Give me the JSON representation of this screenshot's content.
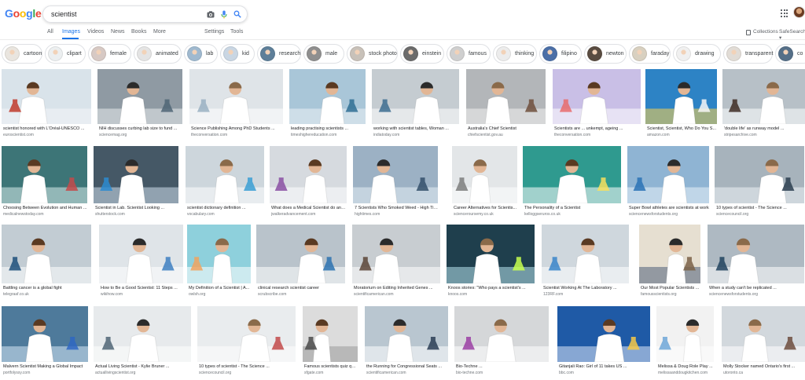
{
  "header": {
    "logo_letters": [
      {
        "ch": "G",
        "color": "#4285f4"
      },
      {
        "ch": "o",
        "color": "#ea4335"
      },
      {
        "ch": "o",
        "color": "#fbbc05"
      },
      {
        "ch": "g",
        "color": "#4285f4"
      },
      {
        "ch": "l",
        "color": "#34a853"
      },
      {
        "ch": "e",
        "color": "#ea4335"
      }
    ],
    "search_value": "scientist",
    "icons": [
      "camera-icon",
      "mic-icon",
      "search-icon"
    ],
    "apps_icon": "apps-grid-icon"
  },
  "tabs": {
    "items": [
      "All",
      "Images",
      "Videos",
      "News",
      "Books",
      "More"
    ],
    "active": "Images",
    "settings": "Settings",
    "tools": "Tools",
    "collections": "Collections",
    "safesearch": "SafeSearch ▾"
  },
  "chips": [
    {
      "label": "cartoon",
      "color": "#e9e5df"
    },
    {
      "label": "clipart",
      "color": "#eceff0"
    },
    {
      "label": "female",
      "color": "#d7c9c4"
    },
    {
      "label": "animated",
      "color": "#e4e4e4"
    },
    {
      "label": "lab",
      "color": "#9fb9cf"
    },
    {
      "label": "kid",
      "color": "#c9d6e3"
    },
    {
      "label": "research",
      "color": "#5e7f99"
    },
    {
      "label": "male",
      "color": "#8f8f8f"
    },
    {
      "label": "stock photo",
      "color": "#c8c1b9"
    },
    {
      "label": "einstein",
      "color": "#6b6b6b"
    },
    {
      "label": "famous",
      "color": "#cfcfcf"
    },
    {
      "label": "thinking",
      "color": "#ececec"
    },
    {
      "label": "filipino",
      "color": "#4b6fa7"
    },
    {
      "label": "newton",
      "color": "#5a4c41"
    },
    {
      "label": "faraday",
      "color": "#d8d0c0"
    },
    {
      "label": "drawing",
      "color": "#f0f0f0"
    },
    {
      "label": "transparent",
      "color": "#e1dcd6"
    },
    {
      "label": "co",
      "color": "#556f88"
    }
  ],
  "rows": [
    {
      "tiles": [
        {
          "caption": "scientist honored with L'Oréal-UNESCO ...",
          "source": "euroscientist.com",
          "bg": "#d9e3ea",
          "fg": "#f4f6f7",
          "accent": "#c0392b"
        },
        {
          "caption": "NIH discusses curbing lab size to fund ...",
          "source": "sciencemag.org",
          "bg": "#8f9aa3",
          "fg": "#e9ecee",
          "accent": "#4f6576"
        },
        {
          "caption": "Science Publishing Among PhD Students ...",
          "source": "theconversation.com",
          "bg": "#dfe4e8",
          "fg": "#ffffff",
          "accent": "#9ab0c2"
        },
        {
          "caption": "leading practising scientists ...",
          "source": "timeshighereducation.com",
          "bg": "#a9c6d8",
          "fg": "#edf2f5",
          "accent": "#2f6f94"
        },
        {
          "caption": "working with scientist tables, Woman ...",
          "source": "indiatoday.com",
          "bg": "#c5ccd1",
          "fg": "#ffffff",
          "accent": "#3c6c90"
        },
        {
          "caption": "Australia's Chief Scientist",
          "source": "chiefscientist.gov.au",
          "bg": "#b3b6b9",
          "fg": "#f2f2f2",
          "accent": "#6f4f3c"
        },
        {
          "caption": "Scientists are ... unkempt, ageing ...",
          "source": "theconversation.com",
          "bg": "#c9bfe6",
          "fg": "#ffffff",
          "accent": "#e76b6b"
        },
        {
          "caption": "Scientist, Scientist, Who Do You S...",
          "source": "amazon.com",
          "bg": "#2d83c5",
          "fg": "#ffd34d",
          "accent": "#f7f7f7"
        },
        {
          "caption": "'double life' as runway model ...",
          "source": "stripesarchive.com",
          "bg": "#b7c0c7",
          "fg": "#ffffff",
          "accent": "#3e2c23"
        }
      ]
    },
    {
      "tiles": [
        {
          "caption": "Choosing Between Evolution and Human ...",
          "source": "medicalnewstoday.com",
          "bg": "#3d7577",
          "fg": "#d9ecec",
          "accent": "#c44a4a"
        },
        {
          "caption": "Scientist in Lab. Scientist Looking ...",
          "source": "shutterstock.com",
          "bg": "#455866",
          "fg": "#cfe0ec",
          "accent": "#2b8bd0"
        },
        {
          "caption": "scientist dictionary definition ...",
          "source": "vocabulary.com",
          "bg": "#cdd6dc",
          "fg": "#ffffff",
          "accent": "#3a9fd4"
        },
        {
          "caption": "What does a Medical Scientist do and...",
          "source": "jwalkeradvancement.com",
          "bg": "#d6dadf",
          "fg": "#ffffff",
          "accent": "#8a4fa3"
        },
        {
          "caption": "7 Scientists Who Smoked Weed - High Times",
          "source": "hightimes.com",
          "bg": "#9cb1c4",
          "fg": "#e6eef5",
          "accent": "#34506b"
        },
        {
          "caption": "Career Alternatives for Scientis...",
          "source": "scienceroursemy.co.uk",
          "bg": "#e3e6e8",
          "fg": "#ffffff",
          "accent": "#7c7c7c"
        },
        {
          "caption": "The Personality of a Scientist",
          "source": "kelloggseruros.co.uk",
          "bg": "#2f9a8f",
          "fg": "#ffffff",
          "accent": "#f7e15e"
        },
        {
          "caption": "Super Bowl athletes are scientists at work",
          "source": "sciencenewsforstudents.org",
          "bg": "#8fb4d3",
          "fg": "#e9f2f9",
          "accent": "#2a72b5"
        },
        {
          "caption": "10 types of scientist - The Science ...",
          "source": "sciencecouncil.org",
          "bg": "#a7b3bc",
          "fg": "#eef2f5",
          "accent": "#2c3e50"
        }
      ]
    },
    {
      "tiles": [
        {
          "caption": "Battling cancer is a global fight",
          "source": "telegraaf.co.uk",
          "bg": "#c2ccd3",
          "fg": "#ffffff",
          "accent": "#1d4f7a"
        },
        {
          "caption": "How to Be a Good Scientist: 11 Steps ...",
          "source": "wikihow.com",
          "bg": "#dfe4e8",
          "fg": "#ffffff",
          "accent": "#3e7fc1"
        },
        {
          "caption": "My Definition of a Scientist | A...",
          "source": "owlsh.org",
          "bg": "#8ed0dc",
          "fg": "#ffffff",
          "accent": "#f0a35e"
        },
        {
          "caption": "clinical research scientist career",
          "source": "scrubscribe.com",
          "bg": "#b9c3cb",
          "fg": "#ffffff",
          "accent": "#2b72b0"
        },
        {
          "caption": "Moratorium on Editing Inherited Genes ...",
          "source": "scientificamerican.com",
          "bg": "#c8cdd1",
          "fg": "#ffffff",
          "accent": "#5b4437"
        },
        {
          "caption": "Knoos stories: \"Who pays a scientist's ...",
          "source": "knoos.com",
          "bg": "#1f3f4d",
          "fg": "#b7e4ef",
          "accent": "#c7ff4f"
        },
        {
          "caption": "Scientist Working At The Laboratory ...",
          "source": "123RF.com",
          "bg": "#cfd7dd",
          "fg": "#ffffff",
          "accent": "#3a85c9"
        },
        {
          "caption": "Our Most Popular Scientists ...",
          "source": "famousscientists.org",
          "bg": "#e6dfd1",
          "fg": "#4f5f7a",
          "accent": "#7a6148"
        },
        {
          "caption": "When a study can't be replicated ...",
          "source": "sciencenewsforstudents.org",
          "bg": "#aeb9c2",
          "fg": "#ffffff",
          "accent": "#20425e"
        }
      ]
    },
    {
      "tiles": [
        {
          "caption": "Malvern Scientist Making a Global Impact",
          "source": "portfolyssy.com",
          "bg": "#4e7a9b",
          "fg": "#d6e8f5",
          "accent": "#2f67c2"
        },
        {
          "caption": "Actual Living Scientist - Kylie Bruner ...",
          "source": "actuallivingscientist.org",
          "bg": "#e7eaec",
          "fg": "#ffffff",
          "accent": "#4f6576"
        },
        {
          "caption": "10 types of scientist - The Science ...",
          "source": "sciencecouncil.org",
          "bg": "#e9ecee",
          "fg": "#ffffff",
          "accent": "#c24a4a"
        },
        {
          "caption": "Famous scientists quiz qui...",
          "source": "sfgate.com",
          "bg": "#dcdcdc",
          "fg": "#9a9a9a",
          "accent": "#4a4a4a"
        },
        {
          "caption": "the Running for Congressional Seats ...",
          "source": "scientificamerican.com",
          "bg": "#b9c6d0",
          "fg": "#ffffff",
          "accent": "#2a3d55"
        },
        {
          "caption": "Bio-Techne ...",
          "source": "bio-techne.com",
          "bg": "#d5d7d9",
          "fg": "#ffffff",
          "accent": "#9b3fa3"
        },
        {
          "caption": "Gitanjali Rao: Girl of 11 takes US ...",
          "source": "bbc.com",
          "bg": "#1f5aa6",
          "fg": "#dce8f7",
          "accent": "#f7c948"
        },
        {
          "caption": "Melissa & Doug Role Play ...",
          "source": "melissaanddougkitchen.com",
          "bg": "#f2f2f2",
          "fg": "#ffffff",
          "accent": "#6fa7d8"
        },
        {
          "caption": "Molly Stocker named Ontario's first ...",
          "source": "utoronto.ca",
          "bg": "#d2d8dd",
          "fg": "#ffffff",
          "accent": "#6d4c3d"
        }
      ]
    }
  ]
}
